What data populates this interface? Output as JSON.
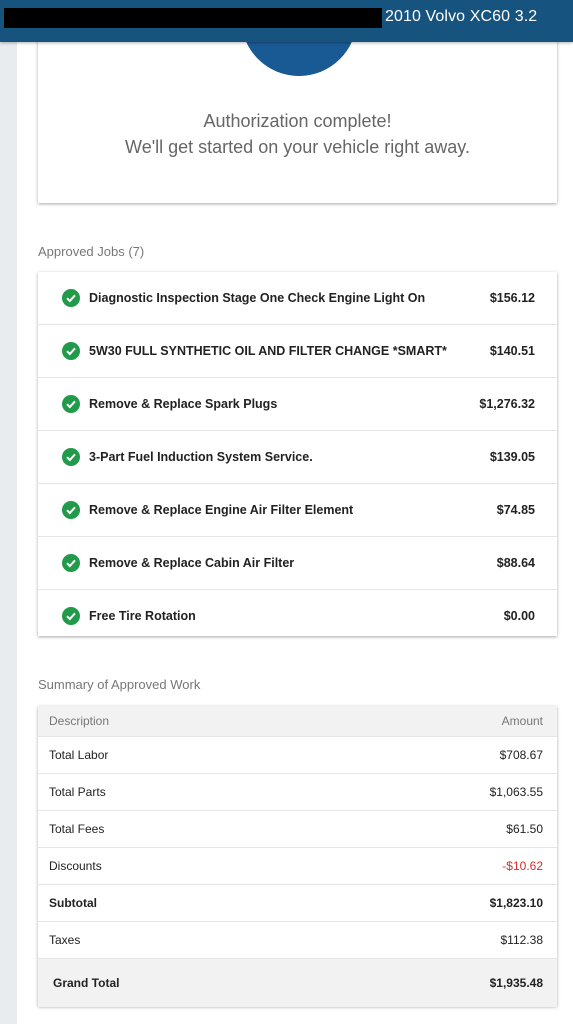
{
  "header": {
    "vehicle": "2010 Volvo XC60 3.2"
  },
  "auth": {
    "line1": "Authorization complete!",
    "line2": "We'll get started on your vehicle right away."
  },
  "jobs": {
    "title": "Approved Jobs (7)",
    "items": [
      {
        "name": "Diagnostic Inspection Stage One Check Engine Light On",
        "price": "$156.12"
      },
      {
        "name": "5W30 FULL SYNTHETIC OIL AND FILTER CHANGE *SMART*",
        "price": "$140.51"
      },
      {
        "name": "Remove & Replace Spark Plugs",
        "price": "$1,276.32"
      },
      {
        "name": "3-Part Fuel Induction System  Service.",
        "price": "$139.05"
      },
      {
        "name": "Remove & Replace Engine Air Filter Element",
        "price": "$74.85"
      },
      {
        "name": "Remove & Replace Cabin Air Filter",
        "price": "$88.64"
      },
      {
        "name": "Free Tire Rotation",
        "price": "$0.00"
      }
    ]
  },
  "summary": {
    "title": "Summary of Approved Work",
    "col_description": "Description",
    "col_amount": "Amount",
    "rows": [
      {
        "label": "Total Labor",
        "value": "$708.67"
      },
      {
        "label": "Total Parts",
        "value": "$1,063.55"
      },
      {
        "label": "Total Fees",
        "value": "$61.50"
      },
      {
        "label": "Discounts",
        "value": "-$10.62"
      },
      {
        "label": "Subtotal",
        "value": "$1,823.10"
      },
      {
        "label": "Taxes",
        "value": "$112.38"
      }
    ],
    "grand_label": "Grand Total",
    "grand_value": "$1,935.48"
  },
  "colors": {
    "header_bg": "#16537e",
    "check_green": "#219a4a",
    "discount_red": "#d32f2f"
  }
}
